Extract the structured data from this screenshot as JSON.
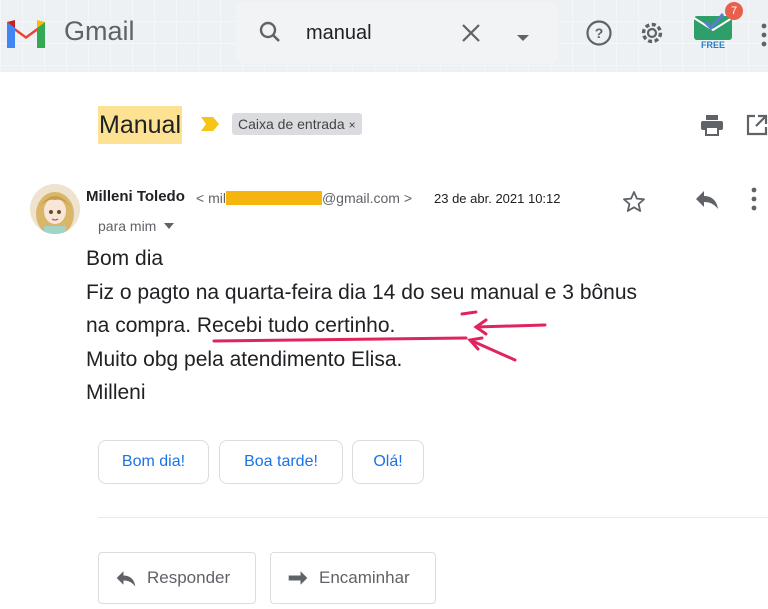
{
  "header": {
    "app_name": "Gmail",
    "search_value": "manual",
    "addon_badge_count": "7",
    "addon_label": "FREE"
  },
  "message": {
    "subject": "Manual",
    "label": "Caixa de entrada",
    "label_remove": "×",
    "sender_name": "Milleni Toledo",
    "email_open": "<",
    "email_prefix": "mil",
    "email_suffix": "@gmail.com",
    "email_close": ">",
    "date": "23 de abr. 2021 10:12",
    "recipient": "para mim",
    "body_lines": [
      "Bom dia",
      "Fiz o pagto na quarta-feira dia 14 do seu manual e 3 bônus",
      "na compra. Recebi tudo certinho.",
      "Muito obg pela atendimento Elisa.",
      "Milleni"
    ]
  },
  "smart_replies": [
    "Bom dia!",
    "Boa tarde!",
    "Olá!"
  ],
  "actions": {
    "reply": "Responder",
    "forward": "Encaminhar"
  },
  "colors": {
    "highlight": "#fde293",
    "annotation": "#e0245e",
    "link_blue": "#1a73e8",
    "mask": "#f6b40e"
  }
}
